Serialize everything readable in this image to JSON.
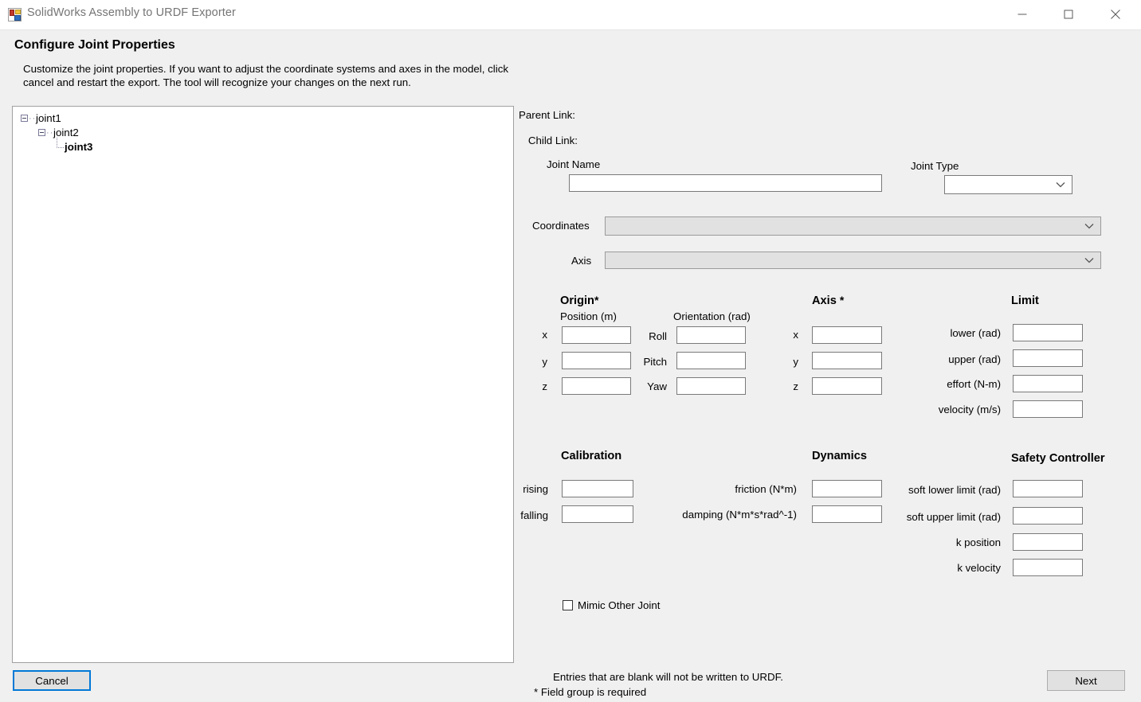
{
  "window": {
    "title": "SolidWorks Assembly to URDF Exporter",
    "icon": "app-icon",
    "controls": {
      "minimize": "minimize-icon",
      "maximize": "maximize-icon",
      "close": "close-icon"
    }
  },
  "header": {
    "title": "Configure Joint Properties",
    "description": "Customize the joint properties. If you want to adjust the coordinate systems and axes in the model, click cancel and restart the export. The tool will recognize your changes on the next run."
  },
  "tree": {
    "nodes": [
      {
        "label": "joint1",
        "expanded": true,
        "depth": 0,
        "selected": false
      },
      {
        "label": "joint2",
        "expanded": true,
        "depth": 1,
        "selected": false
      },
      {
        "label": "joint3",
        "expanded": false,
        "depth": 2,
        "selected": true
      }
    ]
  },
  "form": {
    "parent_link_label": "Parent Link:",
    "parent_link_value": "",
    "child_link_label": "Child Link:",
    "child_link_value": "",
    "joint_name_label": "Joint Name",
    "joint_name_value": "",
    "joint_type_label": "Joint Type",
    "joint_type_value": "",
    "coordinates_label": "Coordinates",
    "coordinates_value": "",
    "axis_select_label": "Axis",
    "axis_select_value": ""
  },
  "origin": {
    "title": "Origin",
    "required_mark": "*",
    "position_header": "Position (m)",
    "orientation_header": "Orientation (rad)",
    "position_rows": [
      {
        "label": "x",
        "value": ""
      },
      {
        "label": "y",
        "value": ""
      },
      {
        "label": "z",
        "value": ""
      }
    ],
    "orientation_rows": [
      {
        "label": "Roll",
        "value": ""
      },
      {
        "label": "Pitch",
        "value": ""
      },
      {
        "label": "Yaw",
        "value": ""
      }
    ]
  },
  "axis": {
    "title": "Axis",
    "required_mark": "*",
    "rows": [
      {
        "label": "x",
        "value": ""
      },
      {
        "label": "y",
        "value": ""
      },
      {
        "label": "z",
        "value": ""
      }
    ]
  },
  "limit": {
    "title": "Limit",
    "rows": [
      {
        "label": "lower (rad)",
        "value": ""
      },
      {
        "label": "upper (rad)",
        "value": ""
      },
      {
        "label": "effort (N-m)",
        "value": ""
      },
      {
        "label": "velocity (m/s)",
        "value": ""
      }
    ]
  },
  "calibration": {
    "title": "Calibration",
    "rows": [
      {
        "label": "rising",
        "value": ""
      },
      {
        "label": "falling",
        "value": ""
      }
    ]
  },
  "dynamics": {
    "title": "Dynamics",
    "rows": [
      {
        "label": "friction (N*m)",
        "value": ""
      },
      {
        "label": "damping (N*m*s*rad^-1)",
        "value": ""
      }
    ]
  },
  "safety_controller": {
    "title": "Safety Controller",
    "rows": [
      {
        "label": "soft lower limit (rad)",
        "value": ""
      },
      {
        "label": "soft upper limit (rad)",
        "value": ""
      },
      {
        "label": "k position",
        "value": ""
      },
      {
        "label": "k velocity",
        "value": ""
      }
    ]
  },
  "mimic": {
    "label": "Mimic Other Joint",
    "checked": false
  },
  "footer": {
    "line1": "Entries that are blank will not be written to URDF.",
    "line2": "* Field group is required"
  },
  "buttons": {
    "cancel": "Cancel",
    "next": "Next"
  },
  "colors": {
    "window_background": "#f0f0f0",
    "panel_background": "#ffffff",
    "focus_accent": "#0078d7",
    "disabled_field": "#e1e1e1",
    "field_border": "#7a7a7a",
    "title_text": "#757575"
  }
}
